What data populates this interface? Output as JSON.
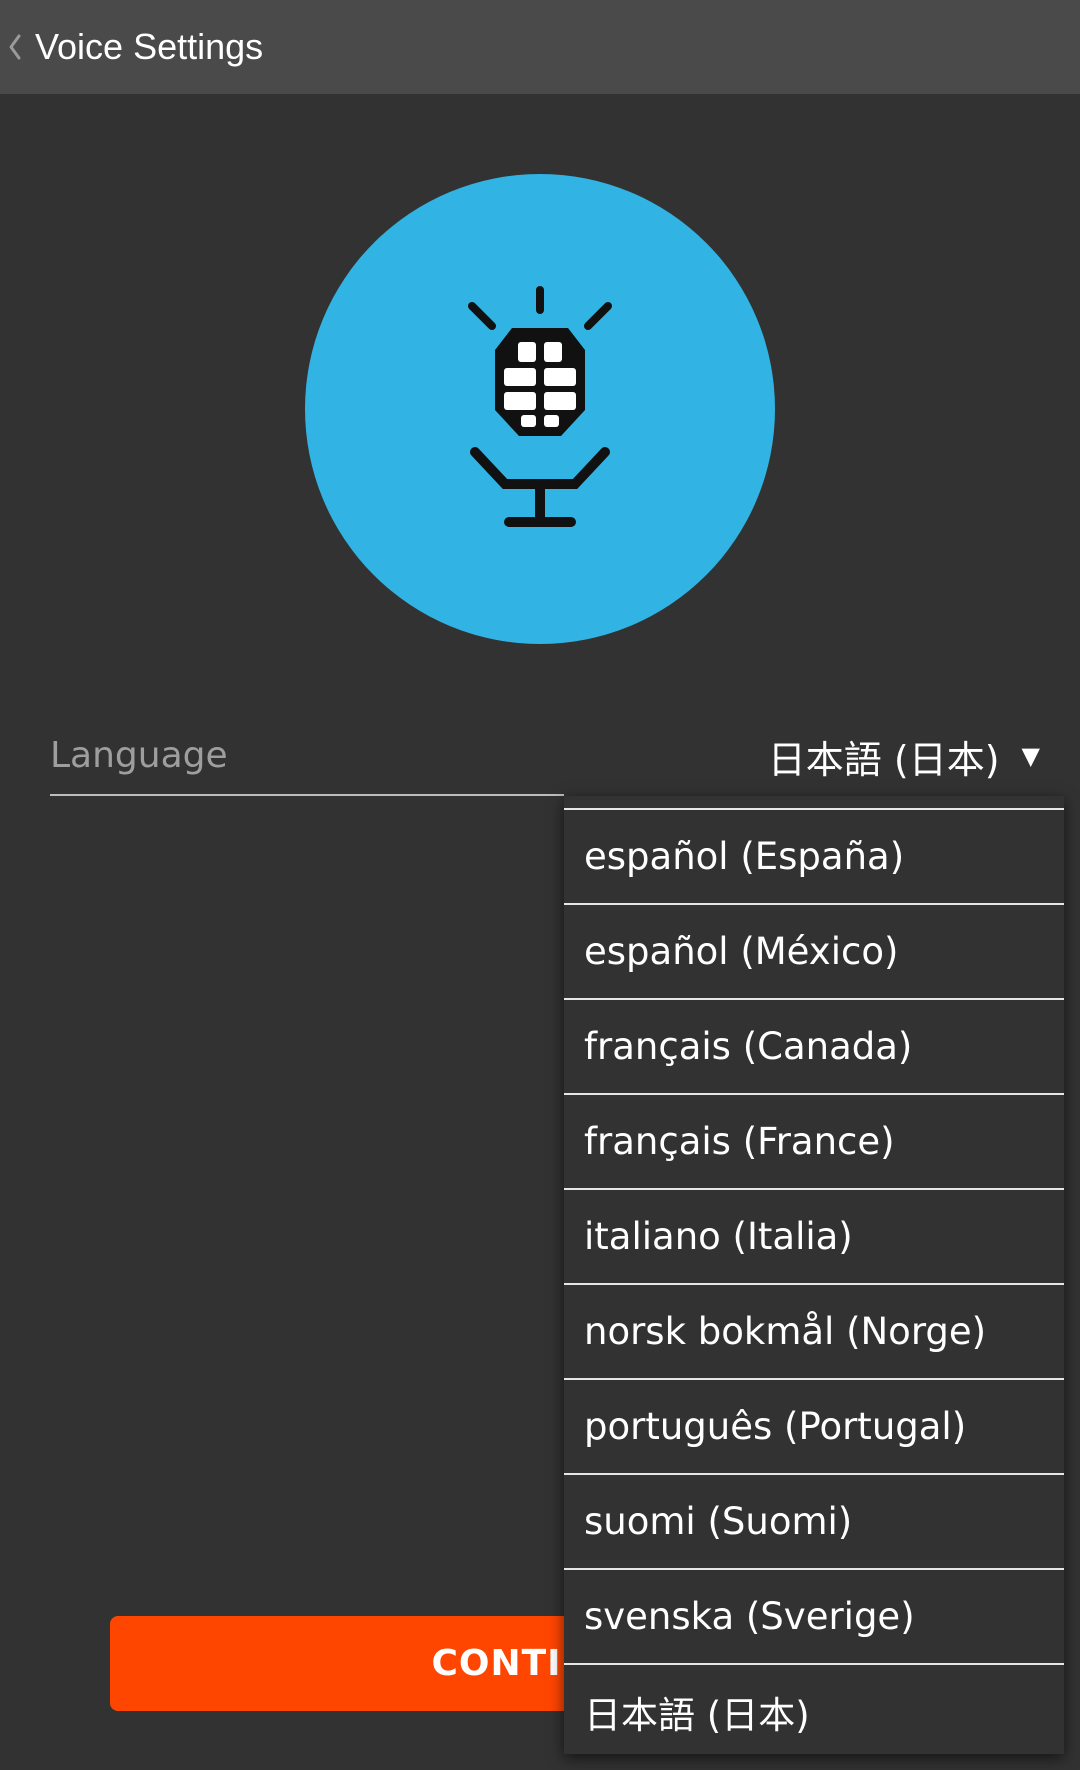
{
  "header": {
    "back_label": "Voice Settings"
  },
  "icons": {
    "back": "chevron-left-icon",
    "mic": "microphone-icon",
    "caret": "dropdown-caret-icon"
  },
  "colors": {
    "topbar": "#4a4a4a",
    "background": "#323232",
    "accent_circle": "#31b3e3",
    "continue_button": "#ff4600"
  },
  "language": {
    "label": "Language",
    "selected": "日本語 (日本)",
    "caret": "▼",
    "options": [
      "español (España)",
      "español (México)",
      "français (Canada)",
      "français (France)",
      "italiano (Italia)",
      "norsk bokmål (Norge)",
      "português (Portugal)",
      "suomi (Suomi)",
      "svenska (Sverige)",
      "日本語 (日本)"
    ]
  },
  "continue_button": {
    "label": "CONTINUE"
  }
}
